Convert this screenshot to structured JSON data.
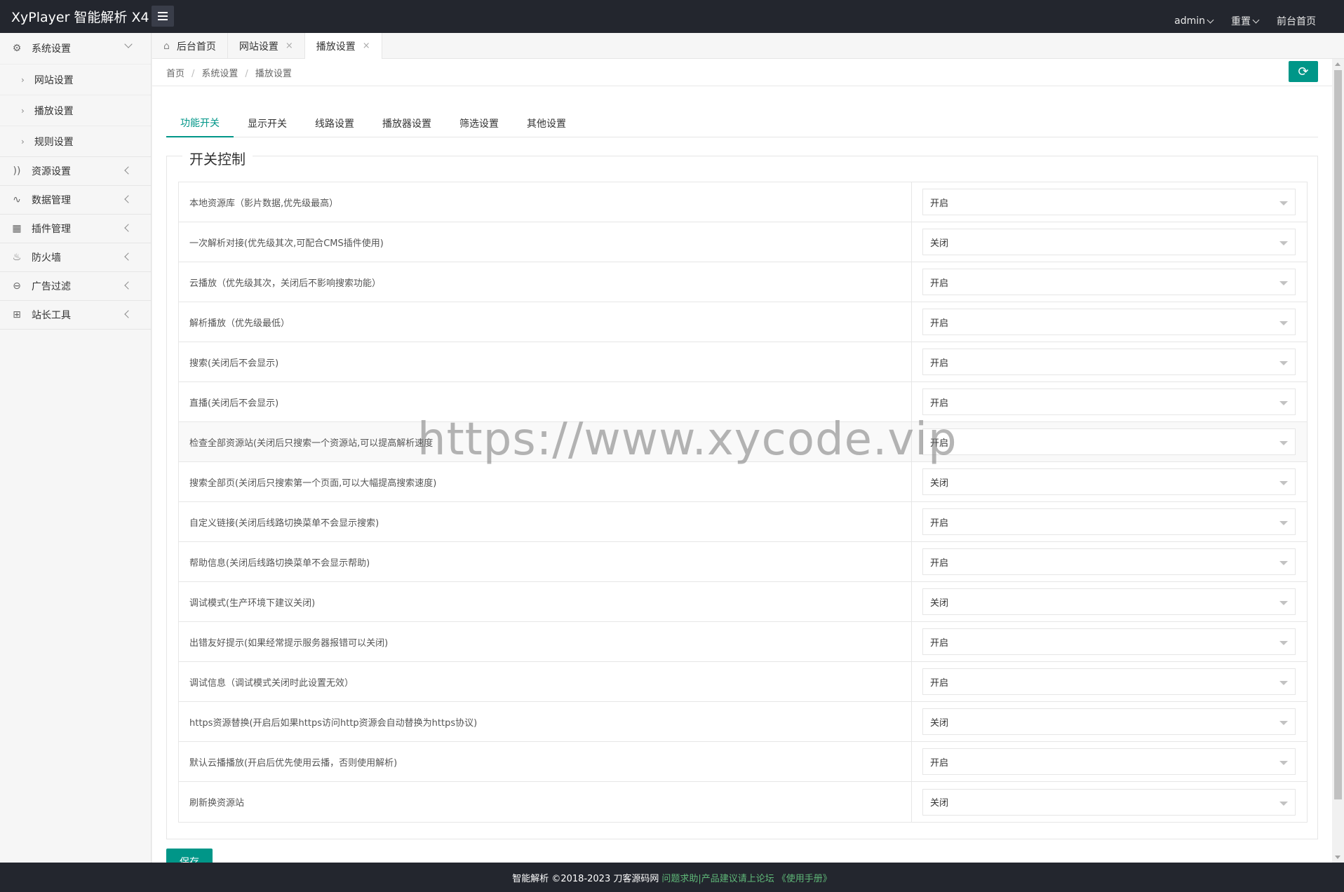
{
  "header": {
    "brand": "XyPlayer 智能解析 X4",
    "links": [
      {
        "label": "admin"
      },
      {
        "label": "重置"
      },
      {
        "label": "前台首页"
      }
    ]
  },
  "sidebar": {
    "groups": [
      {
        "label": "系统设置",
        "icon": "gear-icon",
        "expanded": true,
        "children": [
          {
            "label": "网站设置"
          },
          {
            "label": "播放设置"
          },
          {
            "label": "规则设置"
          }
        ]
      },
      {
        "label": "资源设置",
        "icon": "rss-icon"
      },
      {
        "label": "数据管理",
        "icon": "pulse-icon"
      },
      {
        "label": "插件管理",
        "icon": "plugin-icon"
      },
      {
        "label": "防火墙",
        "icon": "fire-icon"
      },
      {
        "label": "广告过滤",
        "icon": "minus-circle-icon"
      },
      {
        "label": "站长工具",
        "icon": "apps-icon"
      }
    ]
  },
  "tabs": [
    {
      "label": "后台首页",
      "icon": "home-icon"
    },
    {
      "label": "网站设置",
      "close": "×"
    },
    {
      "label": "播放设置",
      "close": "×",
      "active": true
    }
  ],
  "breadcrumb": {
    "items": [
      "首页",
      "系统设置",
      "播放设置"
    ],
    "separator": "/"
  },
  "refresh_icon": "⟳",
  "form_tabs": [
    {
      "label": "功能开关",
      "active": true
    },
    {
      "label": "显示开关"
    },
    {
      "label": "线路设置"
    },
    {
      "label": "播放器设置"
    },
    {
      "label": "筛选设置"
    },
    {
      "label": "其他设置"
    }
  ],
  "fieldset": {
    "legend": "开关控制"
  },
  "settings": [
    {
      "label": "本地资源库（影片数据,优先级最高）",
      "value": "开启"
    },
    {
      "label": "一次解析对接(优先级其次,可配合CMS插件使用)",
      "value": "关闭"
    },
    {
      "label": "云播放（优先级其次，关闭后不影响搜索功能）",
      "value": "开启"
    },
    {
      "label": "解析播放（优先级最低）",
      "value": "开启"
    },
    {
      "label": "搜索(关闭后不会显示)",
      "value": "开启"
    },
    {
      "label": "直播(关闭后不会显示)",
      "value": "开启"
    },
    {
      "label": "检查全部资源站(关闭后只搜索一个资源站,可以提高解析速度",
      "value": "开启"
    },
    {
      "label": "搜索全部页(关闭后只搜索第一个页面,可以大幅提高搜索速度)",
      "value": "关闭"
    },
    {
      "label": "自定义链接(关闭后线路切换菜单不会显示搜索)",
      "value": "开启"
    },
    {
      "label": "帮助信息(关闭后线路切换菜单不会显示帮助)",
      "value": "开启"
    },
    {
      "label": "调试模式(生产环境下建议关闭)",
      "value": "关闭"
    },
    {
      "label": "出错友好提示(如果经常提示服务器报错可以关闭)",
      "value": "开启"
    },
    {
      "label": "调试信息（调试模式关闭时此设置无效）",
      "value": "开启"
    },
    {
      "label": "https资源替换(开启后如果https访问http资源会自动替换为https协议)",
      "value": "关闭"
    },
    {
      "label": "默认云播播放(开启后优先使用云播，否则使用解析)",
      "value": "开启"
    },
    {
      "label": "刷新换资源站",
      "value": "关闭"
    }
  ],
  "save_label": "保存",
  "footer": {
    "copyright": "智能解析 ©2018-2023 刀客源码网",
    "help": "问题求助|产品建议请上论坛",
    "manual": "《使用手册》"
  },
  "watermark": "https://www.xycode.vip",
  "colors": {
    "accent": "#009688",
    "header_bg": "#23262e",
    "footer_link": "#5fb878"
  }
}
